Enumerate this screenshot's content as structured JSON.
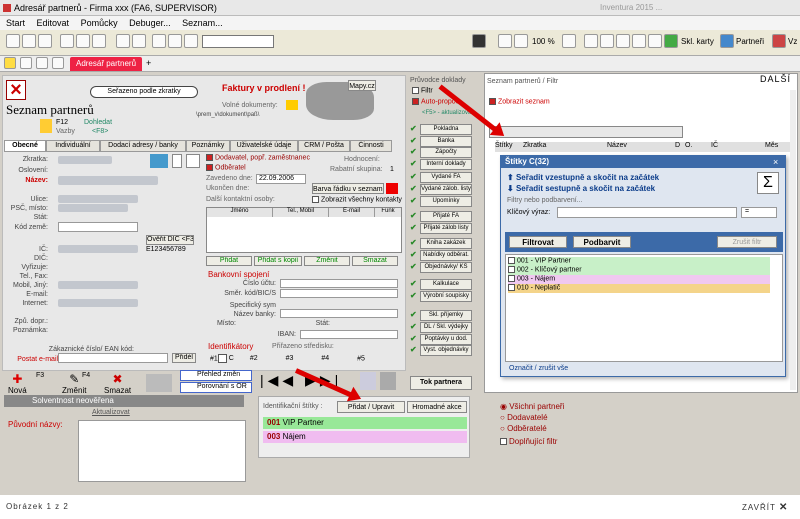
{
  "window": {
    "title": "Adresář partnerů - Firma xxx (FA6, SUPERVISOR)",
    "title_right": "Inventura 2015 ..."
  },
  "menu": [
    "Start",
    "Editovat",
    "Pomůcky",
    "Debuger...",
    "Seznam..."
  ],
  "toolbar": {
    "zoom": "100 %",
    "skl_karty": "Skl. karty",
    "partneri": "Partneři",
    "vz": "Vz"
  },
  "tab": {
    "label": "Adresář partnerů",
    "plus": "+"
  },
  "dalsi": "DALŠÍ",
  "left": {
    "title": "Seznam partnerů",
    "sort_badge": "Seřazeno podle zkratky",
    "overdue": "Faktury v prodlení !",
    "map": "Mapy.cz",
    "volne": "Volné dokumenty:",
    "docpath": "\\prem_v\\dokument\\paß\\",
    "f12": "F12",
    "dohledat": "Dohledat",
    "f8": "<F8>",
    "vazby": "Vazby",
    "tabs": [
      "Obecné",
      "Individuální",
      "Dodací adresy / banky",
      "Poznámky",
      "Uživatelské údaje",
      "CRM / Pošta",
      "Činnosti"
    ],
    "fields": [
      "Zkratka:",
      "Oslovení:",
      "Název:",
      "Ulice:",
      "PSČ, místo:",
      "Stát:",
      "Kód země:",
      "IČ:",
      "DIČ:",
      "Vyřizuje:",
      "Tel., Fax:",
      "Mobil, Jiný:",
      "E-mail:",
      "Internet:",
      "Způ. dopr.:",
      "Poznámka:",
      "Zákaznické číslo/ EAN kód:",
      "Postat e-mail:"
    ],
    "overit": "Ověřit DIČ <F3>",
    "dic_val": "E123456789",
    "pridel": "Přidél",
    "dodavatel": "Dodavatel, popř. zaměstnanec",
    "odberatel": "Odběratel",
    "hodnoceni": "Hodnocení:",
    "zavedeno": "Zavedeno dne:",
    "zavedeno_val": "22.09.2006",
    "ukonceno": "Ukončen dne:",
    "rabat": "Rabatní skupina:",
    "rabat_val": "1",
    "barva": "Barva řádku v seznamu",
    "dalsi_kontakty": "Další kontaktní osoby:",
    "zobrazit_kontakty": "Zobrazit všechny kontakty",
    "contact_cols": [
      "Jméno",
      "Tel., Mobil",
      "E-mail",
      "Funk"
    ],
    "contact_btns": [
      "Přidat",
      "Přidat s kopií",
      "Změnit",
      "Smazat"
    ],
    "bank_title": "Bankovní spojení",
    "bank_fields": [
      "Číslo účtu:",
      "Směr. kód/BIC/S",
      "Specifický sym",
      "Název banky:",
      "Místo:",
      "IBAN:"
    ],
    "stat": "Stát:",
    "ident": "Identifikátory",
    "prirazeno": "Přiřazeno středisku:",
    "ident_nums": [
      "#1",
      "#2",
      "#3",
      "#4",
      "#5"
    ],
    "ident_c": "C",
    "bottom_btns": [
      {
        "key": "F3",
        "label": "Nová"
      },
      {
        "key": "F4",
        "label": "Změnit"
      },
      {
        "key": "",
        "label": "Smazat"
      }
    ],
    "prehled": "Přehled změn",
    "porovnani": "Porovnání s OR",
    "tok": "Tok partnera"
  },
  "middle": {
    "title": "Průvodce doklady",
    "filtr": "Filtr",
    "autopropoc": "Auto-propoč",
    "f5": "<F5> - aktualizovat",
    "buttons": [
      "Pokladna",
      "Banka",
      "Zápočty",
      "Interní doklady",
      "Vydané FA",
      "Vydané zálob. listy",
      "Upomínky",
      "Přijaté FA",
      "Přijaté zálob listy",
      "Kniha zakázek",
      "Nabídky odběrat.",
      "Objednávky/ KS",
      "Kalkulace",
      "Výrobní soupisky",
      "Skl. příjemky",
      "DL / Skl. výdejky",
      "Poptávky u dod.",
      "Vyst. objednávky"
    ]
  },
  "right": {
    "title": "Seznam partnerů / Filtr",
    "zobrazit": "Zobrazit seznam",
    "cols": [
      "Štítky",
      "Zkratka",
      "Název",
      "D",
      "O.",
      "IČ",
      "Měs"
    ],
    "popup": {
      "title": "Štítky C(32)",
      "asc": "Seřadit vzestupně a skočit na začátek",
      "desc": "Seřadit sestupně a skočit na začátek",
      "sigma": "Σ",
      "hint": "Filtry nebo podbarvení...",
      "klicovy": "Klíčový výraz:",
      "eq": "=",
      "filtrovat": "Filtrovat",
      "podbarvit": "Podbarvit",
      "zrusit": "Zrušit filtr",
      "items": [
        {
          "label": "001 - VIP Partner",
          "color": "#c8f0c8"
        },
        {
          "label": "002 - Klíčový partner",
          "color": "#c8f0c8"
        },
        {
          "label": "003 - Nájem",
          "color": "#f0c8f0"
        },
        {
          "label": "010 - Neplatič",
          "color": "#f4d48a"
        }
      ],
      "oznacit": "Označit / zrušit vše"
    }
  },
  "lower": {
    "solvent": "Solventnost neověřena",
    "aktualizovat": "Aktualizovat",
    "puvodni": "Původní názvy:",
    "ident_label": "Identifikační štítky :",
    "pridat": "Přidat / Upravit",
    "hromadne": "Hromadné akce",
    "tags": [
      {
        "code": "001",
        "label": "VIP Partner",
        "color": "#98e898"
      },
      {
        "code": "003",
        "label": "Nájem",
        "color": "#f0bcf0"
      }
    ],
    "radios": [
      "Všichni partneři",
      "Dodavatelé",
      "Odběratelé"
    ],
    "doplnujici": "Doplňující filtr"
  },
  "footer": {
    "caption": "Obrázek 1 z 2",
    "close": "ZAVŘÍT"
  },
  "colors": {
    "arrow": "#dd0000",
    "popup_title": "#3c6aa8",
    "panel": "#d4d0c8"
  }
}
